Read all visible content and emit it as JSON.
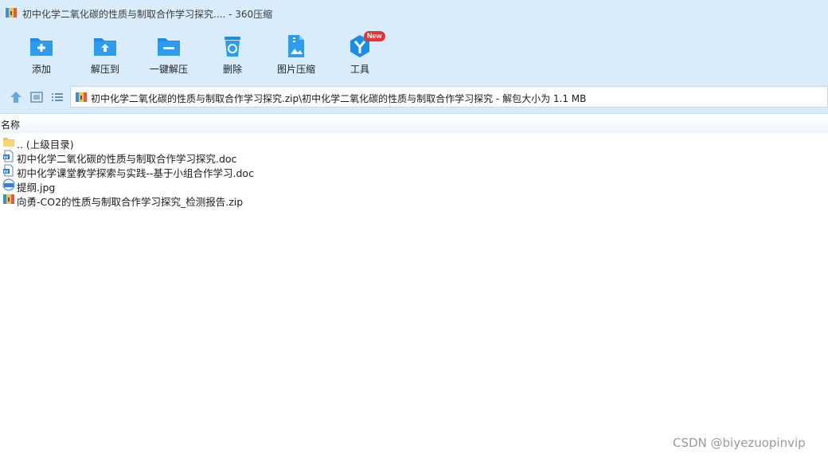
{
  "window": {
    "title": "初中化学二氧化碳的性质与制取合作学习探究.... - 360压缩"
  },
  "toolbar": {
    "items": [
      {
        "label": "添加",
        "icon": "add-folder-icon"
      },
      {
        "label": "解压到",
        "icon": "extract-to-icon"
      },
      {
        "label": "一键解压",
        "icon": "one-click-extract-icon"
      },
      {
        "label": "删除",
        "icon": "trash-icon"
      },
      {
        "label": "图片压缩",
        "icon": "image-compress-icon"
      },
      {
        "label": "工具",
        "icon": "tools-icon",
        "badge": "New"
      }
    ]
  },
  "navbar": {
    "buttons": [
      "up-arrow-icon",
      "thumbnail-view-icon",
      "list-view-icon"
    ],
    "address": "初中化学二氧化碳的性质与制取合作学习探究.zip\\初中化学二氧化碳的性质与制取合作学习探究 - 解包大小为 1.1 MB"
  },
  "filelist": {
    "column_name": "名称",
    "rows": [
      {
        "name": ".. (上级目录)",
        "icon": "folder-icon"
      },
      {
        "name": "初中化学二氧化碳的性质与制取合作学习探究.doc",
        "icon": "doc-file-icon"
      },
      {
        "name": "初中化学课堂教学探索与实践--基于小组合作学习.doc",
        "icon": "doc-file-icon"
      },
      {
        "name": "提纲.jpg",
        "icon": "jpg-file-icon"
      },
      {
        "name": "向勇-CO2的性质与制取合作学习探究_检测报告.zip",
        "icon": "zip-file-icon"
      }
    ]
  },
  "watermark": "CSDN @biyezuopinvip",
  "colors": {
    "accent": "#1a8ee6",
    "chrome": "#d9ecfc",
    "badge": "#e8332f"
  }
}
